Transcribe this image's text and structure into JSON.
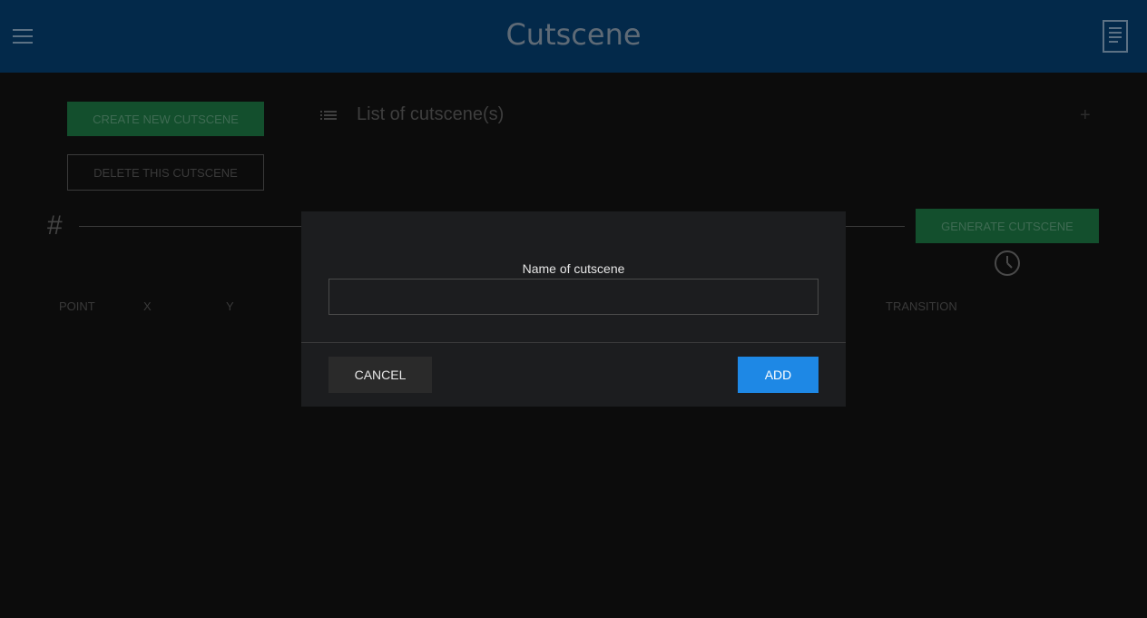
{
  "header": {
    "title": "Cutscene",
    "menu_icon": "hamburger-menu-icon",
    "doc_icon": "document-icon"
  },
  "sidebar": {
    "create_label": "CREATE NEW CUTSCENE",
    "delete_label": "DELETE THIS CUTSCENE"
  },
  "list": {
    "title": "List of cutscene(s)",
    "list_icon": "list-icon",
    "add_icon": "plus-icon"
  },
  "timeline": {
    "hash": "#",
    "generate_label": "GENERATE CUTSCENE",
    "clock_icon": "clock-icon"
  },
  "table": {
    "columns": [
      "POINT",
      "X",
      "Y",
      "TRANSITION"
    ]
  },
  "modal": {
    "label": "Name of cutscene",
    "input_value": "",
    "cancel_label": "CANCEL",
    "add_label": "ADD"
  },
  "colors": {
    "header_bg": "#03294a",
    "page_bg": "#0c0c0c",
    "green_button": "#134f2d",
    "modal_bg": "#1c1d1f",
    "primary_blue": "#1e88e5"
  }
}
